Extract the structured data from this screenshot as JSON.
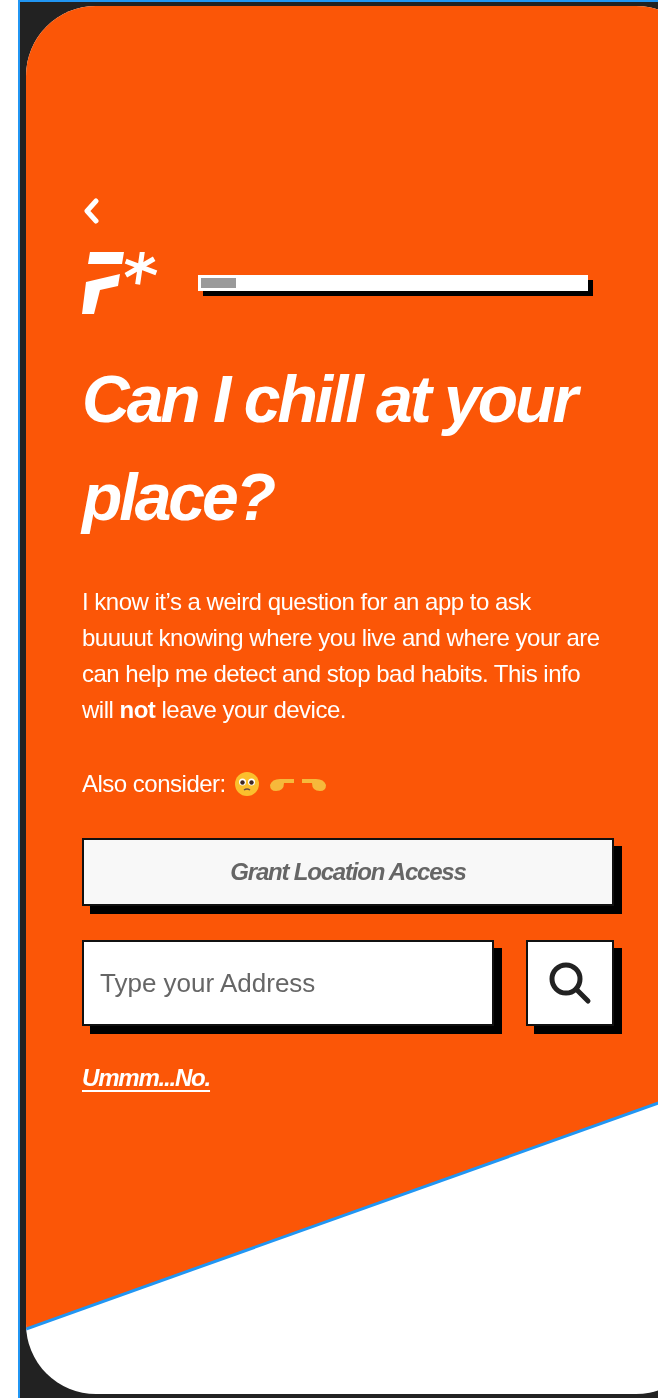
{
  "progress": {
    "level": 0.09
  },
  "title": "Can I chill at your place?",
  "body": "I know it’s a weird question for an app to ask buuuut knowing where you live and where your are can help me detect and stop bad habits. This info will **not** leave your device.",
  "also_consider": "Also consider:",
  "grant_button": "Grant Location Access",
  "address_field": {
    "placeholder": "Type your Address"
  },
  "decline_link": "Ummm...No."
}
